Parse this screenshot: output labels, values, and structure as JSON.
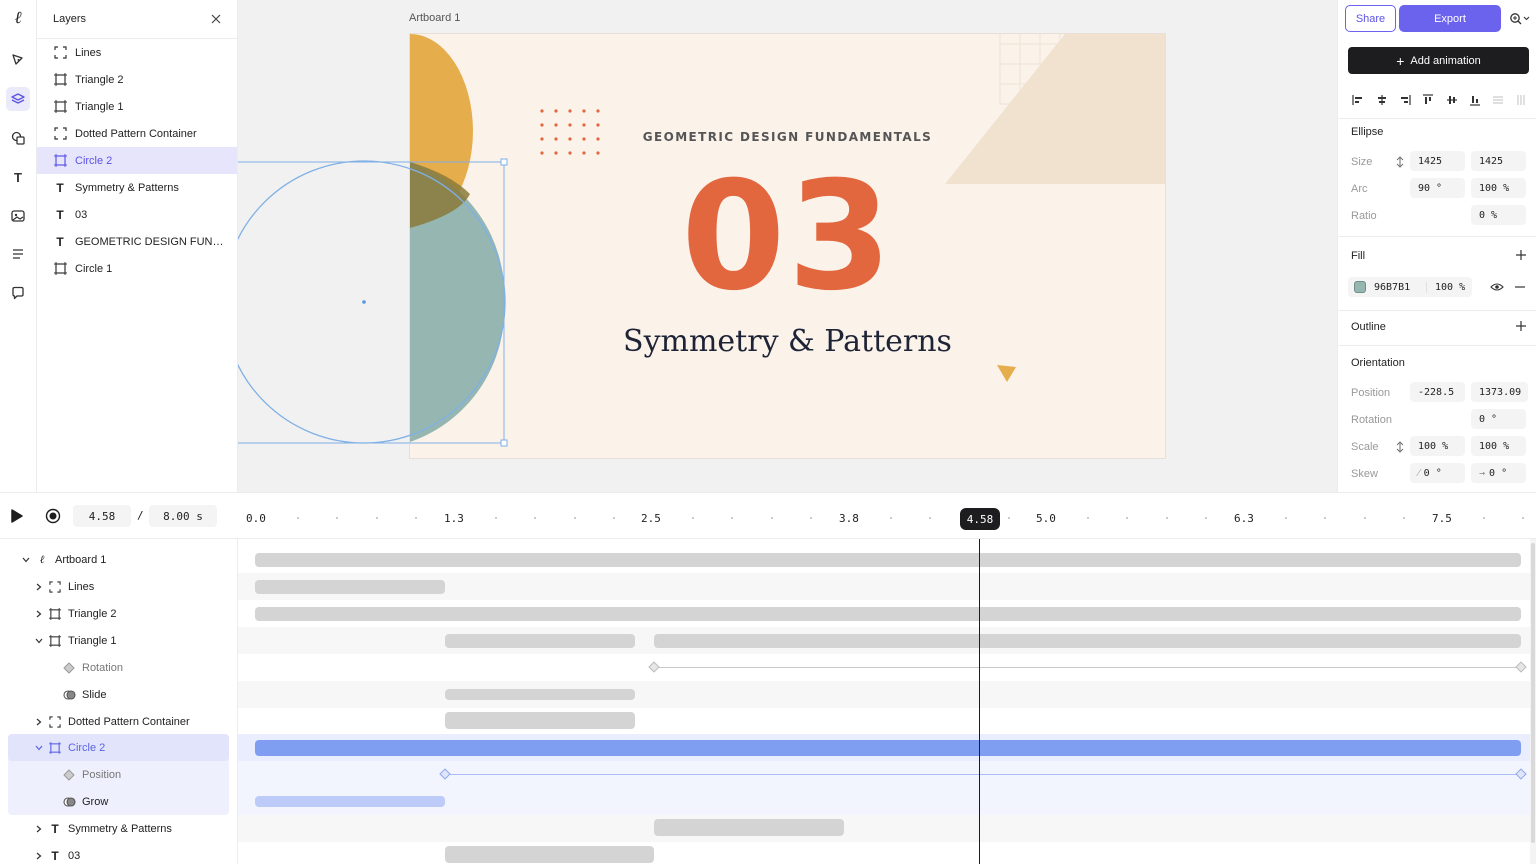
{
  "app": {
    "logo_glyph": "ℓ",
    "accent_color": "#6b63ee"
  },
  "toolbar": {
    "tools": [
      "select-tool",
      "pen-tool",
      "layers-tool",
      "shapes-tool",
      "text-tool",
      "image-tool",
      "align-tool",
      "comment-tool"
    ],
    "text_tool_glyph": "T"
  },
  "layers_panel": {
    "title": "Layers",
    "items": [
      {
        "label": "Lines",
        "type": "group"
      },
      {
        "label": "Triangle 2",
        "type": "shape"
      },
      {
        "label": "Triangle 1",
        "type": "shape"
      },
      {
        "label": "Dotted Pattern Container",
        "type": "group"
      },
      {
        "label": "Circle 2",
        "type": "shape",
        "selected": true
      },
      {
        "label": "Symmetry & Patterns",
        "type": "text"
      },
      {
        "label": "03",
        "type": "text"
      },
      {
        "label": "GEOMETRIC DESIGN FUNDAMENTALS",
        "type": "text"
      },
      {
        "label": "Circle 1",
        "type": "shape"
      }
    ]
  },
  "canvas": {
    "artboard_label": "Artboard 1",
    "artboard": {
      "subtitle": "GEOMETRIC DESIGN FUNDAMENTALS",
      "number": "03",
      "title": "Symmetry & Patterns",
      "colors": {
        "background": "#fbf2ea",
        "orange": "#e2673f",
        "gold": "#e6ad4c",
        "teal": "#96b7b1",
        "navy": "#1e2436"
      }
    }
  },
  "props": {
    "share_label": "Share",
    "export_label": "Export",
    "add_animation_label": "Add animation",
    "ellipse": {
      "title": "Ellipse",
      "size_label": "Size",
      "size_w": "1425",
      "size_h": "1425",
      "arc_label": "Arc",
      "arc_angle": "90 °",
      "arc_percent": "100 %",
      "ratio_label": "Ratio",
      "ratio_value": "0 %"
    },
    "fill": {
      "title": "Fill",
      "hex": "96B7B1",
      "opacity": "100 %",
      "swatch_color": "#96b7b1"
    },
    "outline": {
      "title": "Outline"
    },
    "orientation": {
      "title": "Orientation",
      "position_label": "Position",
      "position_x": "-228.5",
      "position_y": "1373.09",
      "rotation_label": "Rotation",
      "rotation_value": "0 °",
      "scale_label": "Scale",
      "scale_x": "100 %",
      "scale_y": "100 %",
      "skew_label": "Skew",
      "skew_x": "0 °",
      "skew_y": "0 °"
    }
  },
  "timeline": {
    "current_time": "4.58",
    "separator": "/",
    "duration": "8.00 s",
    "playhead_label": "4.58",
    "ruler_labels": [
      "0.0",
      "1.3",
      "2.5",
      "3.8",
      "5.0",
      "6.3",
      "7.5"
    ],
    "tree": [
      {
        "label": "Artboard 1",
        "kind": "artboard",
        "indent": 0,
        "expanded": true
      },
      {
        "label": "Lines",
        "kind": "group",
        "indent": 1
      },
      {
        "label": "Triangle 2",
        "kind": "shape",
        "indent": 1
      },
      {
        "label": "Triangle 1",
        "kind": "shape",
        "indent": 1,
        "expanded": true
      },
      {
        "label": "Rotation",
        "kind": "keyframe",
        "indent": 2
      },
      {
        "label": "Slide",
        "kind": "animation",
        "indent": 2
      },
      {
        "label": "Dotted Pattern Container",
        "kind": "group",
        "indent": 1
      },
      {
        "label": "Circle 2",
        "kind": "shape",
        "indent": 1,
        "expanded": true,
        "selected": true
      },
      {
        "label": "Position",
        "kind": "keyframe",
        "indent": 2
      },
      {
        "label": "Grow",
        "kind": "animation",
        "indent": 2
      },
      {
        "label": "Symmetry & Patterns",
        "kind": "text",
        "indent": 1
      },
      {
        "label": "03",
        "kind": "text",
        "indent": 1
      }
    ]
  }
}
